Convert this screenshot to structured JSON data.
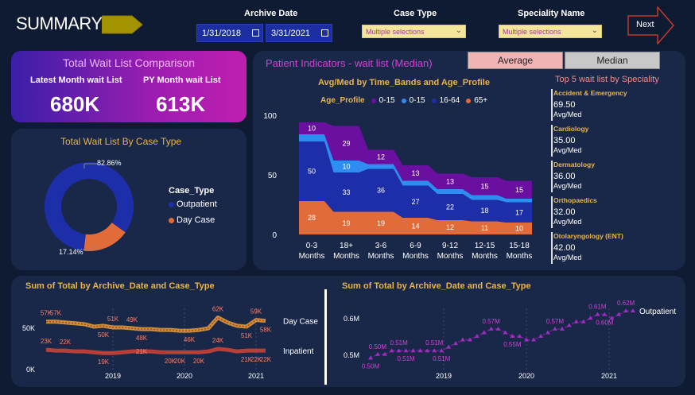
{
  "header": {
    "title": "SUMMARY",
    "archive_date_label": "Archive Date",
    "date_from": "1/31/2018",
    "date_to": "3/31/2021",
    "case_type_label": "Case Type",
    "case_type_value": "Multiple selections",
    "speciality_label": "Speciality Name",
    "speciality_value": "Multiple selections",
    "next_label": "Next"
  },
  "kpi": {
    "title": "Total Wait List Comparison",
    "latest_label": "Latest Month wait List",
    "latest_value": "680K",
    "py_label": "PY Month wait List",
    "py_value": "613K"
  },
  "donut": {
    "title": "Total Wait List By Case Type",
    "legend_title": "Case_Type",
    "legend": [
      "Outpatient",
      "Day Case"
    ],
    "label_big": "82.86%",
    "label_small": "17.14%",
    "colors": {
      "outpatient": "#1c2ea8",
      "day_case": "#e26b3a"
    }
  },
  "indicators": {
    "title": "Patient Indicators - wait list (Median)",
    "toggle_average": "Average",
    "toggle_median": "Median",
    "chart_title": "Avg/Med by Time_Bands and Age_Profile",
    "legend_title": "Age_Profile",
    "legend": [
      "0-15",
      "0-15",
      "16-64",
      "65+"
    ]
  },
  "top5": {
    "title": "Top 5 wait list by Speciality",
    "items": [
      {
        "name": "Accident & Emergency",
        "value": "69.50",
        "sub": "Avg/Med"
      },
      {
        "name": "Cardiology",
        "value": "35.00",
        "sub": "Avg/Med"
      },
      {
        "name": "Dermatology",
        "value": "36.00",
        "sub": "Avg/Med"
      },
      {
        "name": "Orthopaedics",
        "value": "32.00",
        "sub": "Avg/Med"
      },
      {
        "name": "Otolaryngology (ENT)",
        "value": "42.00",
        "sub": "Avg/Med"
      }
    ]
  },
  "chart_data": [
    {
      "type": "area",
      "title": "Avg/Med by Time_Bands and Age_Profile",
      "stacked": true,
      "categories": [
        "0-3 Months",
        "18+ Months",
        "3-6 Months",
        "6-9 Months",
        "9-12 Months",
        "12-15 Months",
        "15-18 Months"
      ],
      "ylim": [
        0,
        100
      ],
      "yticks": [
        "0",
        "50",
        "100"
      ],
      "series": [
        {
          "name": "65+",
          "color": "#e26b3a",
          "values": [
            28,
            19,
            19,
            14,
            12,
            11,
            10
          ]
        },
        {
          "name": "16-64",
          "color": "#1c2ea8",
          "values": [
            50,
            33,
            36,
            27,
            22,
            18,
            17
          ]
        },
        {
          "name": "0-15",
          "color": "#2f8cf0",
          "values": [
            6,
            10,
            4,
            4,
            4,
            4,
            3
          ]
        },
        {
          "name": "0-15",
          "color": "#6a0fa0",
          "values": [
            10,
            29,
            12,
            13,
            13,
            15,
            15
          ]
        }
      ],
      "labels": [
        [
          "28",
          "50",
          "",
          "10"
        ],
        [
          "19",
          "33",
          "10",
          "29"
        ],
        [
          "19",
          "36",
          "",
          "12"
        ],
        [
          "14",
          "27",
          "",
          "13"
        ],
        [
          "12",
          "22",
          "",
          "13"
        ],
        [
          "11",
          "18",
          "",
          "15"
        ],
        [
          "10",
          "17",
          "",
          "15"
        ]
      ]
    },
    {
      "type": "line",
      "title": "Sum of Total by Archive_Date and Case_Type",
      "x_ticks": [
        "2019",
        "2020",
        "2021"
      ],
      "y_ticks": [
        "50K",
        "0K"
      ],
      "series": [
        {
          "name": "Day Case",
          "color": "#e5a23a",
          "values": [
            57,
            57,
            56,
            55,
            54,
            51,
            52,
            50,
            50,
            49,
            48,
            48,
            47,
            47,
            46,
            46,
            47,
            49,
            62,
            56,
            52,
            51,
            59,
            58
          ]
        },
        {
          "name": "Inpatient",
          "color": "#d0453a",
          "values": [
            23,
            22,
            22,
            21,
            21,
            20,
            19,
            19,
            20,
            21,
            21,
            21,
            20,
            20,
            20,
            20,
            20,
            21,
            24,
            23,
            21,
            22,
            22,
            22
          ]
        }
      ],
      "point_labels": [
        {
          "series": 0,
          "i": 0,
          "text": "57K",
          "pos": "above"
        },
        {
          "series": 0,
          "i": 1,
          "text": "57K",
          "pos": "above"
        },
        {
          "series": 0,
          "i": 7,
          "text": "51K",
          "pos": "above"
        },
        {
          "series": 0,
          "i": 9,
          "text": "49K",
          "pos": "above"
        },
        {
          "series": 0,
          "i": 18,
          "text": "62K",
          "pos": "above"
        },
        {
          "series": 0,
          "i": 22,
          "text": "59K",
          "pos": "above"
        },
        {
          "series": 0,
          "i": 6,
          "text": "50K",
          "pos": "below"
        },
        {
          "series": 0,
          "i": 10,
          "text": "48K",
          "pos": "below"
        },
        {
          "series": 0,
          "i": 15,
          "text": "46K",
          "pos": "below"
        },
        {
          "series": 0,
          "i": 21,
          "text": "51K",
          "pos": "below"
        },
        {
          "series": 0,
          "i": 23,
          "text": "58K",
          "pos": "below"
        },
        {
          "series": 1,
          "i": 0,
          "text": "23K",
          "pos": "above"
        },
        {
          "series": 1,
          "i": 2,
          "text": "22K",
          "pos": "above"
        },
        {
          "series": 1,
          "i": 18,
          "text": "24K",
          "pos": "above"
        },
        {
          "series": 1,
          "i": 10,
          "text": "21K",
          "pos": "on"
        },
        {
          "series": 1,
          "i": 6,
          "text": "19K",
          "pos": "below"
        },
        {
          "series": 1,
          "i": 13,
          "text": "20K",
          "pos": "below"
        },
        {
          "series": 1,
          "i": 14,
          "text": "20K",
          "pos": "below"
        },
        {
          "series": 1,
          "i": 16,
          "text": "20K",
          "pos": "below"
        },
        {
          "series": 1,
          "i": 21,
          "text": "21K",
          "pos": "below"
        },
        {
          "series": 1,
          "i": 22,
          "text": "22K",
          "pos": "below"
        },
        {
          "series": 1,
          "i": 23,
          "text": "22K",
          "pos": "below"
        }
      ]
    },
    {
      "type": "line",
      "title": "Sum of Total by Archive_Date and Case_Type",
      "x_ticks": [
        "2019",
        "2020",
        "2021"
      ],
      "y_ticks": [
        "0.6M",
        "0.5M"
      ],
      "series": [
        {
          "name": "Outpatient",
          "color": "#7b1a9a",
          "values": [
            0.49,
            0.5,
            0.5,
            0.51,
            0.51,
            0.51,
            0.51,
            0.51,
            0.51,
            0.51,
            0.51,
            0.52,
            0.53,
            0.54,
            0.54,
            0.55,
            0.56,
            0.57,
            0.57,
            0.56,
            0.55,
            0.55,
            0.54,
            0.54,
            0.55,
            0.56,
            0.57,
            0.57,
            0.58,
            0.59,
            0.59,
            0.6,
            0.61,
            0.61,
            0.6,
            0.61,
            0.62,
            0.62
          ]
        }
      ],
      "point_labels": [
        {
          "i": 0,
          "text": "0.50M",
          "pos": "below"
        },
        {
          "i": 1,
          "text": "0.50M",
          "pos": "above"
        },
        {
          "i": 4,
          "text": "0.51M",
          "pos": "above"
        },
        {
          "i": 5,
          "text": "0.51M",
          "pos": "below"
        },
        {
          "i": 9,
          "text": "0.51M",
          "pos": "above"
        },
        {
          "i": 10,
          "text": "0.51M",
          "pos": "below"
        },
        {
          "i": 17,
          "text": "0.57M",
          "pos": "above"
        },
        {
          "i": 20,
          "text": "0.55M",
          "pos": "below"
        },
        {
          "i": 26,
          "text": "0.57M",
          "pos": "above"
        },
        {
          "i": 32,
          "text": "0.61M",
          "pos": "above"
        },
        {
          "i": 33,
          "text": "0.60M",
          "pos": "below"
        },
        {
          "i": 36,
          "text": "0.62M",
          "pos": "above"
        }
      ]
    }
  ],
  "colors": {
    "background": "#0f1a33",
    "panel": "#192848",
    "accent_pink": "#d63fd8",
    "gold": "#e9b44c"
  }
}
